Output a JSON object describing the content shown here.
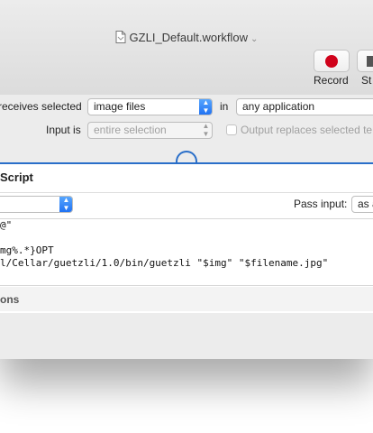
{
  "window": {
    "title": "GZLI_Default.workflow",
    "title_chevron": "⌄"
  },
  "toolbar": {
    "record_label": "Record",
    "stop_label": "St"
  },
  "header": {
    "receives_label": "receives selected",
    "receives_value": "image files",
    "in_label": "in",
    "application_value": "any application",
    "input_is_label": "Input is",
    "input_is_value": "entire selection",
    "output_replaces_label": "Output replaces selected te"
  },
  "action": {
    "title": "Script",
    "pass_input_label": "Pass input:",
    "pass_input_value": "as a",
    "code_lines": [
      "@\"",
      "",
      "mg%.*}OPT",
      "l/Cellar/guetzli/1.0/bin/guetzli \"$img\" \"$filename.jpg\""
    ],
    "options_label": "ons"
  },
  "colors": {
    "accent": "#2a6fc9",
    "record": "#d0021b",
    "popup_blue": "#1d6ff2"
  }
}
